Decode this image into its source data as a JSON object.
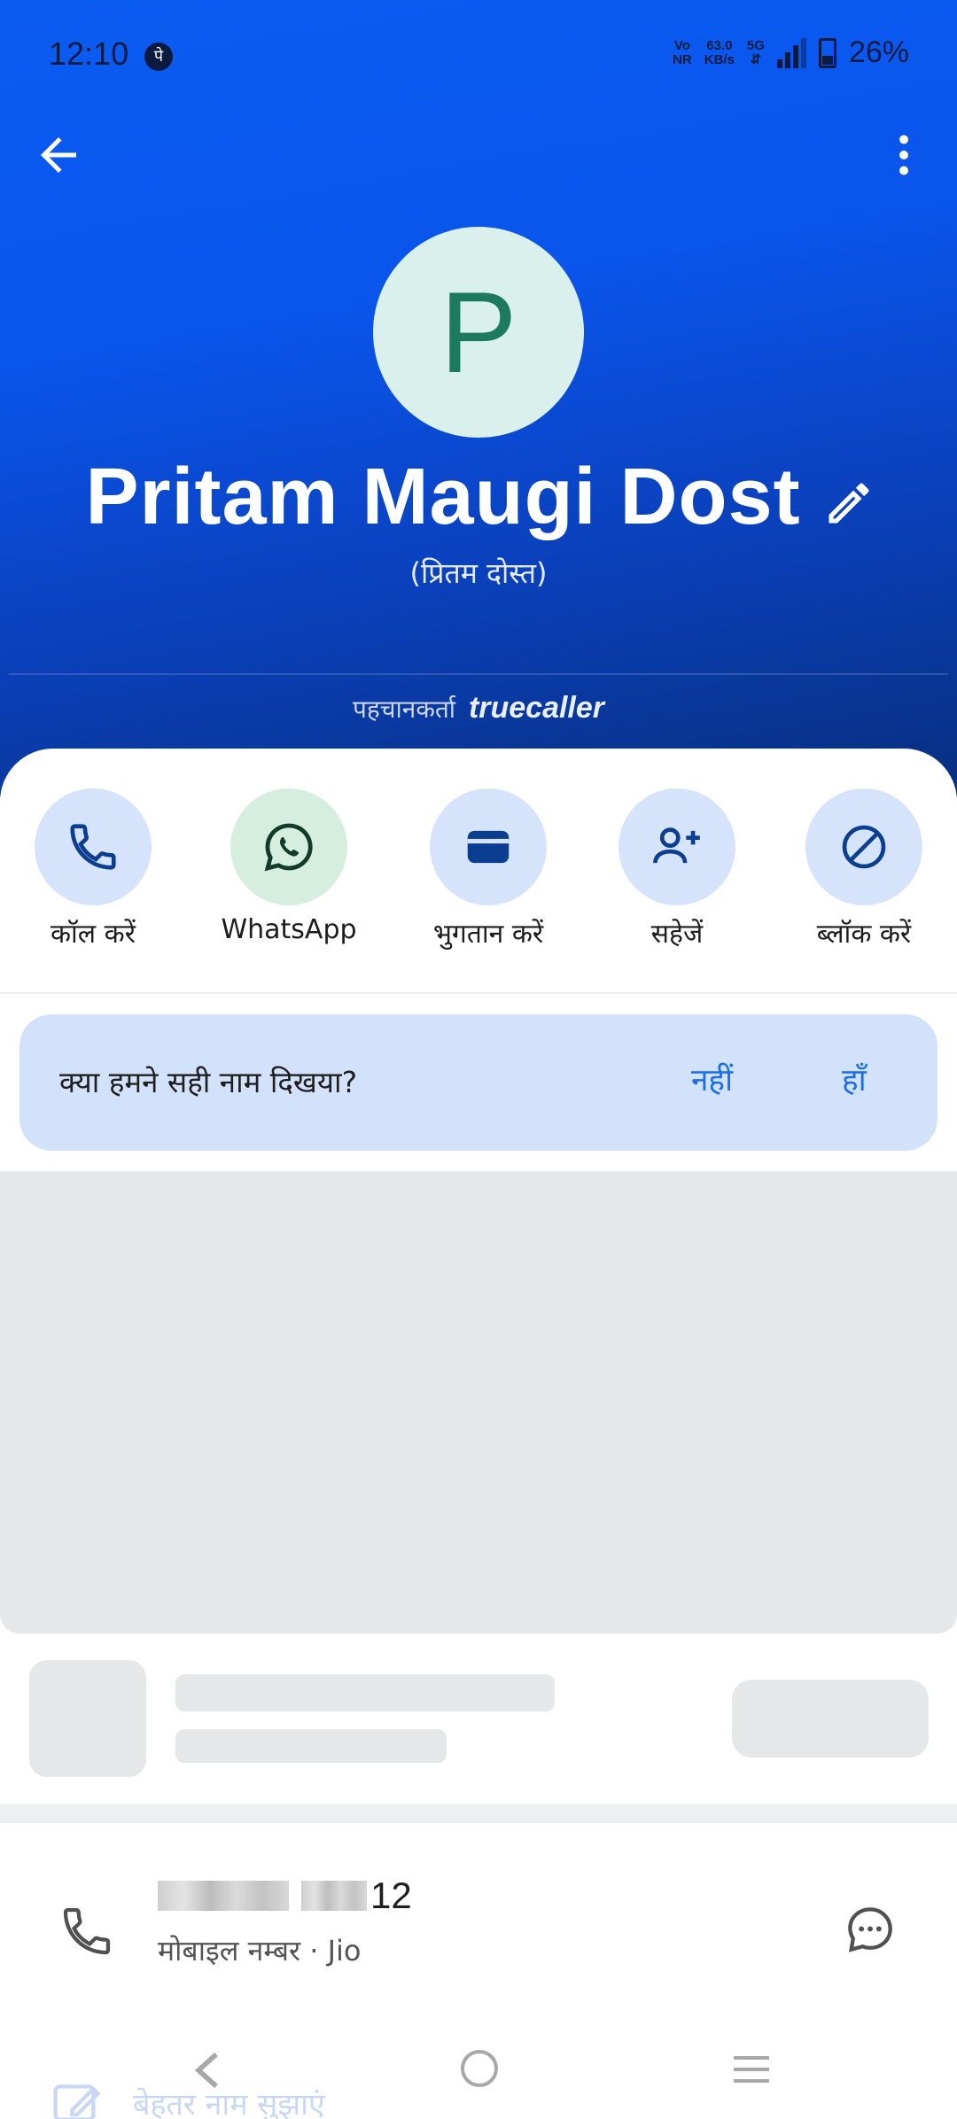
{
  "status_bar": {
    "time": "12:10",
    "upi_glyph": "पे",
    "volte_top": "Vo",
    "volte_bottom": "NR",
    "speed_top": "63.0",
    "speed_bottom": "KB/s",
    "net_top": "5G",
    "net_bottom": "⇵",
    "battery": "26%"
  },
  "contact": {
    "initial": "P",
    "name": "Pritam Maugi Dost",
    "name_alt": "(प्रितम दोस्त)",
    "identified_prefix": "पहचानकर्ता",
    "identified_brand": "truecaller"
  },
  "actions": [
    {
      "label": "कॉल करें",
      "icon": "phone-icon"
    },
    {
      "label": "WhatsApp",
      "icon": "whatsapp-icon"
    },
    {
      "label": "भुगतान करें",
      "icon": "wallet-icon"
    },
    {
      "label": "सहेजें",
      "icon": "add-person-icon"
    },
    {
      "label": "ब्लॉक करें",
      "icon": "block-icon"
    }
  ],
  "feedback": {
    "question": "क्या हमने सही नाम दिखया?",
    "no": "नहीं",
    "yes": "हाँ"
  },
  "phone": {
    "number_visible_tail": "12",
    "subtitle": "मोबाइल नम्बर · Jio"
  },
  "bottom": {
    "suggest_label": "बेहतर नाम सुझाएं"
  },
  "colors": {
    "header_blue": "#0b5cf2",
    "accent": "#1c6ee6",
    "action_bg": "#d6e4fb",
    "whatsapp_bg": "#d5eedf"
  }
}
